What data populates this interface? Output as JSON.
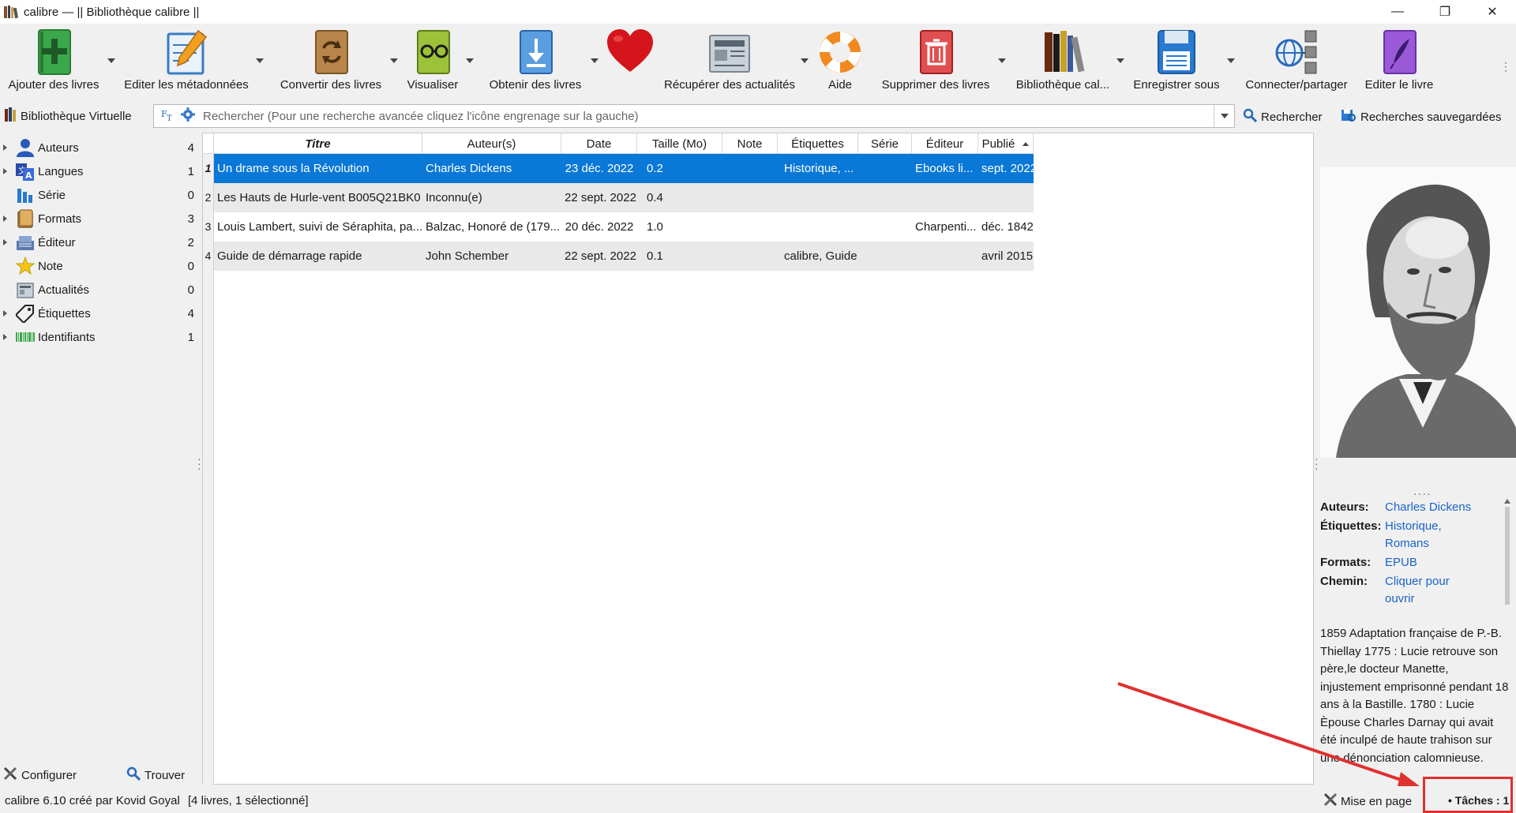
{
  "window": {
    "title": "calibre — || Bibliothèque calibre ||",
    "controls": [
      "—",
      "❐",
      "✕"
    ]
  },
  "toolbar": {
    "buttons": [
      {
        "label": "Ajouter des livres",
        "icon": "add-book-icon"
      },
      {
        "label": "Editer les métadonnées",
        "icon": "edit-metadata-icon"
      },
      {
        "label": "Convertir des livres",
        "icon": "convert-books-icon"
      },
      {
        "label": "Visualiser",
        "icon": "view-book-icon"
      },
      {
        "label": "Obtenir des livres",
        "icon": "get-books-icon"
      },
      {
        "label": "",
        "icon": "donate-heart-icon"
      },
      {
        "label": "Récupérer des actualités",
        "icon": "fetch-news-icon"
      },
      {
        "label": "Aide",
        "icon": "help-lifebuoy-icon"
      },
      {
        "label": "Supprimer des livres",
        "icon": "remove-books-icon"
      },
      {
        "label": "Bibliothèque cal...",
        "icon": "library-books-icon"
      },
      {
        "label": "Enregistrer sous",
        "icon": "save-disk-icon"
      },
      {
        "label": "Connecter/partager",
        "icon": "connect-share-icon"
      },
      {
        "label": "Editer le livre",
        "icon": "edit-book-icon"
      }
    ],
    "more": "⋮"
  },
  "searchbar": {
    "virtual_library": "Bibliothèque Virtuelle",
    "placeholder": "Rechercher (Pour une recherche avancée cliquez l'icône engrenage sur la gauche)",
    "search_button": "Rechercher",
    "saved_searches": "Recherches sauvegardées"
  },
  "tag_browser": {
    "items": [
      {
        "label": "Auteurs",
        "count": "4",
        "expandable": true,
        "icon": "authors-icon"
      },
      {
        "label": "Langues",
        "count": "1",
        "expandable": true,
        "icon": "languages-icon"
      },
      {
        "label": "Série",
        "count": "0",
        "expandable": false,
        "icon": "series-icon"
      },
      {
        "label": "Formats",
        "count": "3",
        "expandable": true,
        "icon": "formats-icon"
      },
      {
        "label": "Éditeur",
        "count": "2",
        "expandable": true,
        "icon": "publisher-icon"
      },
      {
        "label": "Note",
        "count": "0",
        "expandable": false,
        "icon": "rating-star-icon"
      },
      {
        "label": "Actualités",
        "count": "0",
        "expandable": false,
        "icon": "news-icon"
      },
      {
        "label": "Étiquettes",
        "count": "4",
        "expandable": true,
        "icon": "tags-icon"
      },
      {
        "label": "Identifiants",
        "count": "1",
        "expandable": true,
        "icon": "identifiers-barcode-icon"
      }
    ],
    "configure": "Configurer",
    "find": "Trouver"
  },
  "book_table": {
    "columns": [
      "Titre",
      "Auteur(s)",
      "Date",
      "Taille (Mo)",
      "Note",
      "Étiquettes",
      "Série",
      "Éditeur",
      "Publié"
    ],
    "rows": [
      {
        "num": "1",
        "title": "Un drame sous la Révolution",
        "authors": "Charles Dickens",
        "date": "23 déc. 2022",
        "size": "0.2",
        "rating": "",
        "tags": "Historique, ...",
        "series": "",
        "publisher": "Ebooks li...",
        "published": "sept. 2022"
      },
      {
        "num": "2",
        "title": "Les Hauts de Hurle-vent B005Q21BK0",
        "authors": "Inconnu(e)",
        "date": "22 sept. 2022",
        "size": "0.4",
        "rating": "",
        "tags": "",
        "series": "",
        "publisher": "",
        "published": ""
      },
      {
        "num": "3",
        "title": "Louis Lambert, suivi de Séraphita, pa...",
        "authors": "Balzac, Honoré de (179...",
        "date": "20 déc. 2022",
        "size": "1.0",
        "rating": "",
        "tags": "",
        "series": "",
        "publisher": "Charpenti...",
        "published": "déc. 1842"
      },
      {
        "num": "4",
        "title": "Guide de démarrage rapide",
        "authors": "John Schember",
        "date": "22 sept. 2022",
        "size": "0.1",
        "rating": "",
        "tags": "calibre, Guide",
        "series": "",
        "publisher": "",
        "published": "avril 2015"
      }
    ]
  },
  "book_details": {
    "authors_key": "Auteurs:",
    "authors_val": "Charles Dickens",
    "tags_key": "Étiquettes:",
    "tags_val_1": "Historique,",
    "tags_val_2": "Romans",
    "formats_key": "Formats:",
    "formats_val": "EPUB",
    "path_key": "Chemin:",
    "path_val_1": "Cliquer pour",
    "path_val_2": "ouvrir",
    "synopsis": "1859 Adaptation française de P.-B. Thiellay 1775 : Lucie retrouve son père,le docteur Manette, injustement emprisonné pendant 18 ans à la Bastille. 1780 : Lucie Èpouse Charles Darnay qui avait été inculpé de haute trahison sur une dénonciation calomnieuse."
  },
  "statusbar": {
    "version": "calibre 6.10 créé par Kovid Goyal",
    "count": "[4 livres, 1 sélectionné]",
    "layout": "Mise en page",
    "tasks": "Tâches : 1"
  },
  "colors": {
    "selection": "#0a78d7",
    "link": "#1864c8",
    "annotation": "#e03030"
  }
}
